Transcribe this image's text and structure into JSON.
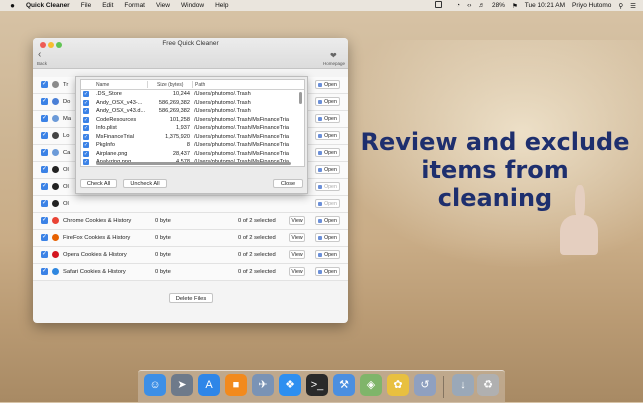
{
  "menubar": {
    "app_name": "Quick Cleaner",
    "items": [
      "File",
      "Edit",
      "Format",
      "View",
      "Window",
      "Help"
    ],
    "battery": "28%",
    "clock": "Tue 10:21 AM",
    "user": "Priyo Hutomo"
  },
  "window": {
    "title": "Free Quick Cleaner",
    "back_label": "Back",
    "homepage_label": "Homepage",
    "delete_button": "Delete Files",
    "view_label": "View",
    "open_label": "Open",
    "rows": [
      {
        "label": "Tr",
        "size": "",
        "selected": "",
        "view": false,
        "open_disabled": false,
        "icon_color": "#8a8a8a"
      },
      {
        "label": "Do",
        "size": "",
        "selected": "",
        "view": false,
        "open_disabled": false,
        "icon_color": "#4a7fd6"
      },
      {
        "label": "Ma",
        "size": "",
        "selected": "",
        "view": false,
        "open_disabled": false,
        "icon_color": "#6b9ad8"
      },
      {
        "label": "Lo",
        "size": "",
        "selected": "",
        "view": false,
        "open_disabled": false,
        "icon_color": "#444444"
      },
      {
        "label": "Ca",
        "size": "",
        "selected": "",
        "view": false,
        "open_disabled": false,
        "icon_color": "#6b9ad8"
      },
      {
        "label": "Ol",
        "size": "",
        "selected": "",
        "view": false,
        "open_disabled": false,
        "icon_color": "#222222"
      },
      {
        "label": "Ol",
        "size": "",
        "selected": "",
        "view": false,
        "open_disabled": true,
        "icon_color": "#222222"
      },
      {
        "label": "Ol",
        "size": "",
        "selected": "",
        "view": false,
        "open_disabled": true,
        "icon_color": "#222222"
      },
      {
        "label": "Chrome Cookies & History",
        "size": "0 byte",
        "selected": "0 of 2 selected",
        "view": true,
        "open_disabled": false,
        "icon_color": "#e94335"
      },
      {
        "label": "FireFox Cookies & History",
        "size": "0 byte",
        "selected": "0 of 2 selected",
        "view": true,
        "open_disabled": false,
        "icon_color": "#e66000"
      },
      {
        "label": "Opera Cookies & History",
        "size": "0 byte",
        "selected": "0 of 2 selected",
        "view": true,
        "open_disabled": false,
        "icon_color": "#d3151f"
      },
      {
        "label": "Safari Cookies & History",
        "size": "0 byte",
        "selected": "0 of 2 selected",
        "view": true,
        "open_disabled": false,
        "icon_color": "#2f87e0"
      }
    ]
  },
  "sheet": {
    "columns": [
      "Name",
      "Size (bytes)",
      "Path"
    ],
    "files": [
      {
        "name": ".DS_Store",
        "size": "10,244",
        "path": "/Users/phutomo/.Trash"
      },
      {
        "name": "Andy_OSX_v43-...",
        "size": "586,269,382",
        "path": "/Users/phutomo/.Trash"
      },
      {
        "name": "Andy_OSX_v43.d...",
        "size": "586,269,382",
        "path": "/Users/phutomo/.Trash"
      },
      {
        "name": "CodeResources",
        "size": "101,258",
        "path": "/Users/phutomo/.Trash/MsFinanceTria"
      },
      {
        "name": "Info.plist",
        "size": "1,937",
        "path": "/Users/phutomo/.Trash/MsFinanceTria"
      },
      {
        "name": "MsFinanceTrial",
        "size": "1,375,920",
        "path": "/Users/phutomo/.Trash/MsFinanceTria"
      },
      {
        "name": "PkgInfo",
        "size": "8",
        "path": "/Users/phutomo/.Trash/MsFinanceTria"
      },
      {
        "name": "Airplane.png",
        "size": "28,437",
        "path": "/Users/phutomo/.Trash/MsFinanceTria"
      },
      {
        "name": "Analyzing.png",
        "size": "4,578",
        "path": "/Users/phutomo/.Trash/MsFinanceTria"
      }
    ],
    "check_all": "Check All",
    "uncheck_all": "Uncheck All",
    "close": "Close"
  },
  "promo": {
    "line1": "Review and exclude",
    "line2": "items from",
    "line3": "cleaning"
  },
  "dock": {
    "apps": [
      {
        "name": "finder-icon",
        "color": "#3d8fe6"
      },
      {
        "name": "launchpad-icon",
        "color": "#6e7a8a"
      },
      {
        "name": "app-store-icon",
        "color": "#2e86e8"
      },
      {
        "name": "ibooks-icon",
        "color": "#f28a1d"
      },
      {
        "name": "preview-icon",
        "color": "#7a93b5"
      },
      {
        "name": "safari-icon",
        "color": "#2d8ff0"
      },
      {
        "name": "terminal-icon",
        "color": "#2a2a2a"
      },
      {
        "name": "xcode-icon",
        "color": "#4b8fe0"
      },
      {
        "name": "maps-icon",
        "color": "#7fb56a"
      },
      {
        "name": "photos-icon",
        "color": "#e8c040"
      },
      {
        "name": "quick-cleaner-icon",
        "color": "#8fa0c0"
      },
      {
        "name": "downloads-icon",
        "color": "#9aa8b8"
      },
      {
        "name": "trash-icon",
        "color": "#b0b0b0"
      }
    ]
  }
}
